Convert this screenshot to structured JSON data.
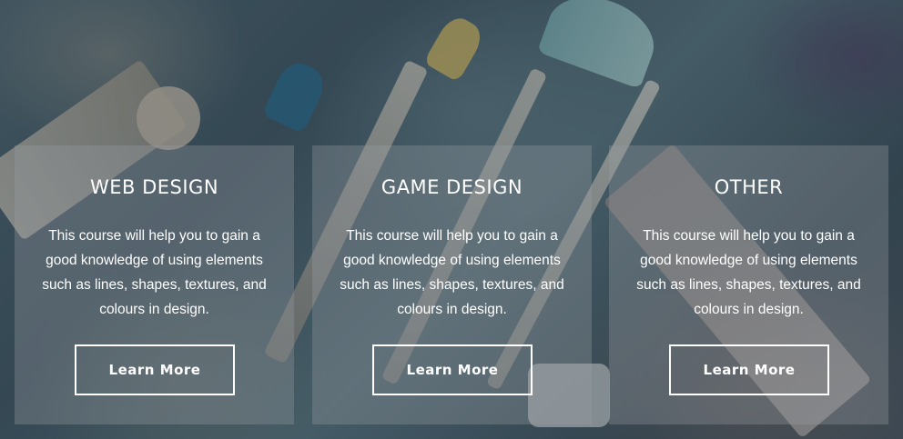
{
  "cards": [
    {
      "title": "WEB DESIGN",
      "description": "This course will help you to gain a good knowledge of using elements such as lines, shapes,  textures, and colours in design.",
      "button_label": "Learn More"
    },
    {
      "title": "GAME DESIGN",
      "description": "This course will help you to gain a good knowledge of using elements such as lines, shapes,  textures, and colours in design.",
      "button_label": "Learn More"
    },
    {
      "title": "OTHER",
      "description": "This course will help you to gain a good knowledge of using elements such as lines, shapes,  textures, and colours in design.",
      "button_label": "Learn More"
    }
  ],
  "colors": {
    "card_overlay": "rgba(155,160,165,0.32)",
    "text": "#ffffff",
    "button_border": "#ffffff"
  }
}
